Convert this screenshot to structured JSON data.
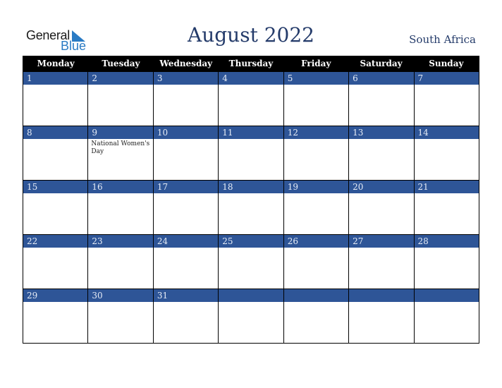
{
  "logo": {
    "word1": "General",
    "word2": "Blue"
  },
  "header": {
    "title": "August 2022",
    "country": "South Africa"
  },
  "weekdays": [
    "Monday",
    "Tuesday",
    "Wednesday",
    "Thursday",
    "Friday",
    "Saturday",
    "Sunday"
  ],
  "weeks": [
    [
      {
        "d": "1",
        "e": ""
      },
      {
        "d": "2",
        "e": ""
      },
      {
        "d": "3",
        "e": ""
      },
      {
        "d": "4",
        "e": ""
      },
      {
        "d": "5",
        "e": ""
      },
      {
        "d": "6",
        "e": ""
      },
      {
        "d": "7",
        "e": ""
      }
    ],
    [
      {
        "d": "8",
        "e": ""
      },
      {
        "d": "9",
        "e": "National Women's Day"
      },
      {
        "d": "10",
        "e": ""
      },
      {
        "d": "11",
        "e": ""
      },
      {
        "d": "12",
        "e": ""
      },
      {
        "d": "13",
        "e": ""
      },
      {
        "d": "14",
        "e": ""
      }
    ],
    [
      {
        "d": "15",
        "e": ""
      },
      {
        "d": "16",
        "e": ""
      },
      {
        "d": "17",
        "e": ""
      },
      {
        "d": "18",
        "e": ""
      },
      {
        "d": "19",
        "e": ""
      },
      {
        "d": "20",
        "e": ""
      },
      {
        "d": "21",
        "e": ""
      }
    ],
    [
      {
        "d": "22",
        "e": ""
      },
      {
        "d": "23",
        "e": ""
      },
      {
        "d": "24",
        "e": ""
      },
      {
        "d": "25",
        "e": ""
      },
      {
        "d": "26",
        "e": ""
      },
      {
        "d": "27",
        "e": ""
      },
      {
        "d": "28",
        "e": ""
      }
    ],
    [
      {
        "d": "29",
        "e": ""
      },
      {
        "d": "30",
        "e": ""
      },
      {
        "d": "31",
        "e": ""
      },
      {
        "d": "",
        "e": ""
      },
      {
        "d": "",
        "e": ""
      },
      {
        "d": "",
        "e": ""
      },
      {
        "d": "",
        "e": ""
      }
    ]
  ],
  "colors": {
    "bar": "#2e5597",
    "title": "#243b6a",
    "logo_blue": "#2a7bc4"
  }
}
